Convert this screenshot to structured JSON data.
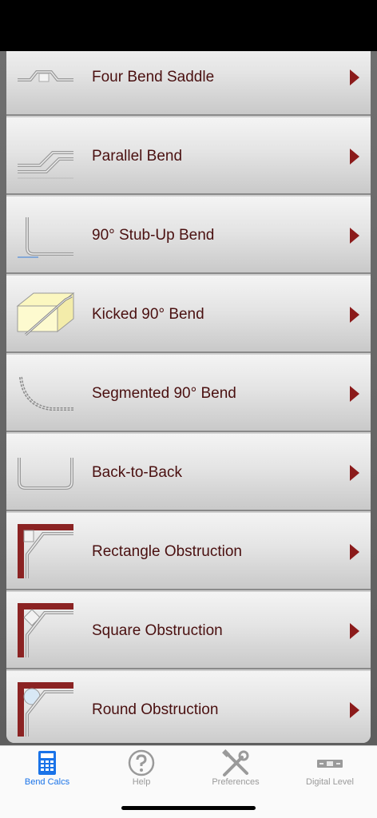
{
  "rows": [
    {
      "label": "Four Bend Saddle",
      "icon": "four-bend-saddle-icon"
    },
    {
      "label": "Parallel Bend",
      "icon": "parallel-bend-icon"
    },
    {
      "label": "90° Stub-Up Bend",
      "icon": "stub-up-bend-icon"
    },
    {
      "label": "Kicked 90° Bend",
      "icon": "kicked-bend-icon"
    },
    {
      "label": "Segmented 90° Bend",
      "icon": "segmented-bend-icon"
    },
    {
      "label": "Back-to-Back",
      "icon": "back-to-back-icon"
    },
    {
      "label": "Rectangle Obstruction",
      "icon": "rectangle-obstruction-icon"
    },
    {
      "label": "Square Obstruction",
      "icon": "square-obstruction-icon"
    },
    {
      "label": "Round Obstruction",
      "icon": "round-obstruction-icon"
    }
  ],
  "tabs": [
    {
      "label": "Bend Calcs",
      "icon": "calculator-icon",
      "active": true
    },
    {
      "label": "Help",
      "icon": "question-mark-icon",
      "active": false
    },
    {
      "label": "Preferences",
      "icon": "tools-icon",
      "active": false
    },
    {
      "label": "Digital Level",
      "icon": "level-icon",
      "active": false
    }
  ],
  "colors": {
    "label": "#4a1010",
    "arrow": "#8b1a1a",
    "tab_active": "#1a73e8",
    "tab_inactive": "#9a9a9a"
  }
}
